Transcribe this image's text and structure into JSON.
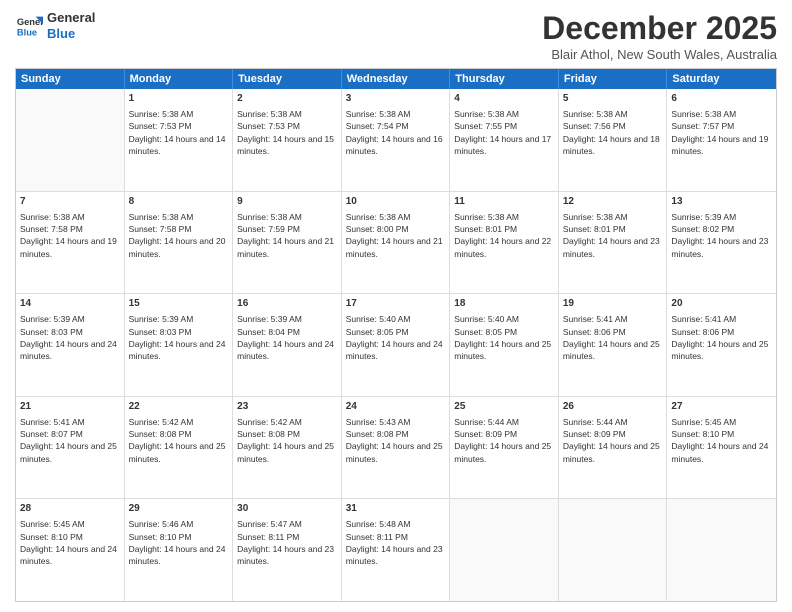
{
  "logo": {
    "line1": "General",
    "line2": "Blue"
  },
  "title": "December 2025",
  "subtitle": "Blair Athol, New South Wales, Australia",
  "headers": [
    "Sunday",
    "Monday",
    "Tuesday",
    "Wednesday",
    "Thursday",
    "Friday",
    "Saturday"
  ],
  "weeks": [
    [
      {
        "day": "",
        "sunrise": "",
        "sunset": "",
        "daylight": ""
      },
      {
        "day": "1",
        "sunrise": "Sunrise: 5:38 AM",
        "sunset": "Sunset: 7:53 PM",
        "daylight": "Daylight: 14 hours and 14 minutes."
      },
      {
        "day": "2",
        "sunrise": "Sunrise: 5:38 AM",
        "sunset": "Sunset: 7:53 PM",
        "daylight": "Daylight: 14 hours and 15 minutes."
      },
      {
        "day": "3",
        "sunrise": "Sunrise: 5:38 AM",
        "sunset": "Sunset: 7:54 PM",
        "daylight": "Daylight: 14 hours and 16 minutes."
      },
      {
        "day": "4",
        "sunrise": "Sunrise: 5:38 AM",
        "sunset": "Sunset: 7:55 PM",
        "daylight": "Daylight: 14 hours and 17 minutes."
      },
      {
        "day": "5",
        "sunrise": "Sunrise: 5:38 AM",
        "sunset": "Sunset: 7:56 PM",
        "daylight": "Daylight: 14 hours and 18 minutes."
      },
      {
        "day": "6",
        "sunrise": "Sunrise: 5:38 AM",
        "sunset": "Sunset: 7:57 PM",
        "daylight": "Daylight: 14 hours and 19 minutes."
      }
    ],
    [
      {
        "day": "7",
        "sunrise": "Sunrise: 5:38 AM",
        "sunset": "Sunset: 7:58 PM",
        "daylight": "Daylight: 14 hours and 19 minutes."
      },
      {
        "day": "8",
        "sunrise": "Sunrise: 5:38 AM",
        "sunset": "Sunset: 7:58 PM",
        "daylight": "Daylight: 14 hours and 20 minutes."
      },
      {
        "day": "9",
        "sunrise": "Sunrise: 5:38 AM",
        "sunset": "Sunset: 7:59 PM",
        "daylight": "Daylight: 14 hours and 21 minutes."
      },
      {
        "day": "10",
        "sunrise": "Sunrise: 5:38 AM",
        "sunset": "Sunset: 8:00 PM",
        "daylight": "Daylight: 14 hours and 21 minutes."
      },
      {
        "day": "11",
        "sunrise": "Sunrise: 5:38 AM",
        "sunset": "Sunset: 8:01 PM",
        "daylight": "Daylight: 14 hours and 22 minutes."
      },
      {
        "day": "12",
        "sunrise": "Sunrise: 5:38 AM",
        "sunset": "Sunset: 8:01 PM",
        "daylight": "Daylight: 14 hours and 23 minutes."
      },
      {
        "day": "13",
        "sunrise": "Sunrise: 5:39 AM",
        "sunset": "Sunset: 8:02 PM",
        "daylight": "Daylight: 14 hours and 23 minutes."
      }
    ],
    [
      {
        "day": "14",
        "sunrise": "Sunrise: 5:39 AM",
        "sunset": "Sunset: 8:03 PM",
        "daylight": "Daylight: 14 hours and 24 minutes."
      },
      {
        "day": "15",
        "sunrise": "Sunrise: 5:39 AM",
        "sunset": "Sunset: 8:03 PM",
        "daylight": "Daylight: 14 hours and 24 minutes."
      },
      {
        "day": "16",
        "sunrise": "Sunrise: 5:39 AM",
        "sunset": "Sunset: 8:04 PM",
        "daylight": "Daylight: 14 hours and 24 minutes."
      },
      {
        "day": "17",
        "sunrise": "Sunrise: 5:40 AM",
        "sunset": "Sunset: 8:05 PM",
        "daylight": "Daylight: 14 hours and 24 minutes."
      },
      {
        "day": "18",
        "sunrise": "Sunrise: 5:40 AM",
        "sunset": "Sunset: 8:05 PM",
        "daylight": "Daylight: 14 hours and 25 minutes."
      },
      {
        "day": "19",
        "sunrise": "Sunrise: 5:41 AM",
        "sunset": "Sunset: 8:06 PM",
        "daylight": "Daylight: 14 hours and 25 minutes."
      },
      {
        "day": "20",
        "sunrise": "Sunrise: 5:41 AM",
        "sunset": "Sunset: 8:06 PM",
        "daylight": "Daylight: 14 hours and 25 minutes."
      }
    ],
    [
      {
        "day": "21",
        "sunrise": "Sunrise: 5:41 AM",
        "sunset": "Sunset: 8:07 PM",
        "daylight": "Daylight: 14 hours and 25 minutes."
      },
      {
        "day": "22",
        "sunrise": "Sunrise: 5:42 AM",
        "sunset": "Sunset: 8:08 PM",
        "daylight": "Daylight: 14 hours and 25 minutes."
      },
      {
        "day": "23",
        "sunrise": "Sunrise: 5:42 AM",
        "sunset": "Sunset: 8:08 PM",
        "daylight": "Daylight: 14 hours and 25 minutes."
      },
      {
        "day": "24",
        "sunrise": "Sunrise: 5:43 AM",
        "sunset": "Sunset: 8:08 PM",
        "daylight": "Daylight: 14 hours and 25 minutes."
      },
      {
        "day": "25",
        "sunrise": "Sunrise: 5:44 AM",
        "sunset": "Sunset: 8:09 PM",
        "daylight": "Daylight: 14 hours and 25 minutes."
      },
      {
        "day": "26",
        "sunrise": "Sunrise: 5:44 AM",
        "sunset": "Sunset: 8:09 PM",
        "daylight": "Daylight: 14 hours and 25 minutes."
      },
      {
        "day": "27",
        "sunrise": "Sunrise: 5:45 AM",
        "sunset": "Sunset: 8:10 PM",
        "daylight": "Daylight: 14 hours and 24 minutes."
      }
    ],
    [
      {
        "day": "28",
        "sunrise": "Sunrise: 5:45 AM",
        "sunset": "Sunset: 8:10 PM",
        "daylight": "Daylight: 14 hours and 24 minutes."
      },
      {
        "day": "29",
        "sunrise": "Sunrise: 5:46 AM",
        "sunset": "Sunset: 8:10 PM",
        "daylight": "Daylight: 14 hours and 24 minutes."
      },
      {
        "day": "30",
        "sunrise": "Sunrise: 5:47 AM",
        "sunset": "Sunset: 8:11 PM",
        "daylight": "Daylight: 14 hours and 23 minutes."
      },
      {
        "day": "31",
        "sunrise": "Sunrise: 5:48 AM",
        "sunset": "Sunset: 8:11 PM",
        "daylight": "Daylight: 14 hours and 23 minutes."
      },
      {
        "day": "",
        "sunrise": "",
        "sunset": "",
        "daylight": ""
      },
      {
        "day": "",
        "sunrise": "",
        "sunset": "",
        "daylight": ""
      },
      {
        "day": "",
        "sunrise": "",
        "sunset": "",
        "daylight": ""
      }
    ]
  ]
}
